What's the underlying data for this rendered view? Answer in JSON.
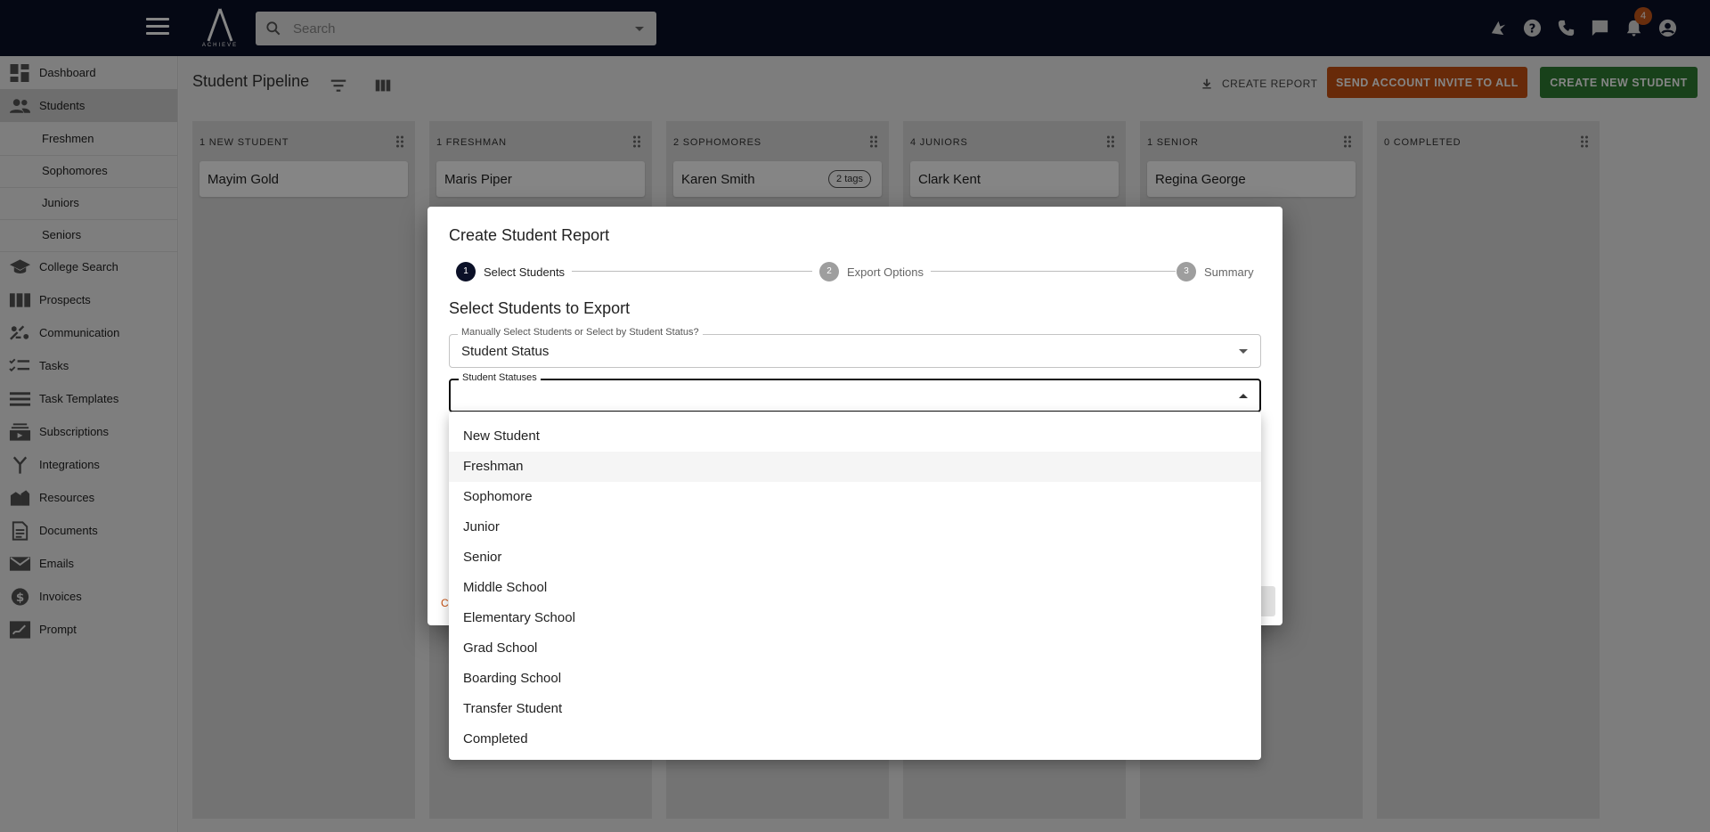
{
  "topbar": {
    "logo_text": "ACHIEVE",
    "search_placeholder": "Search",
    "notification_count": "4"
  },
  "sidebar": {
    "items": [
      {
        "label": "Dashboard",
        "icon": "dashboard-icon"
      },
      {
        "label": "Students",
        "icon": "people-icon"
      },
      {
        "label": "College Search",
        "icon": "school-icon"
      },
      {
        "label": "Prospects",
        "icon": "columns-icon"
      },
      {
        "label": "Communication",
        "icon": "communication-icon"
      },
      {
        "label": "Tasks",
        "icon": "checklist-icon"
      },
      {
        "label": "Task Templates",
        "icon": "list-icon"
      },
      {
        "label": "Subscriptions",
        "icon": "subscriptions-icon"
      },
      {
        "label": "Integrations",
        "icon": "merge-icon"
      },
      {
        "label": "Resources",
        "icon": "resources-icon"
      },
      {
        "label": "Documents",
        "icon": "document-icon"
      },
      {
        "label": "Emails",
        "icon": "mail-icon"
      },
      {
        "label": "Invoices",
        "icon": "dollar-icon"
      },
      {
        "label": "Prompt",
        "icon": "prompt-icon"
      }
    ],
    "student_subitems": [
      "Freshmen",
      "Sophomores",
      "Juniors",
      "Seniors"
    ]
  },
  "main": {
    "title": "Student Pipeline",
    "create_report": "CREATE REPORT",
    "send_invite": "SEND ACCOUNT INVITE TO ALL",
    "create_student": "CREATE NEW STUDENT",
    "columns": [
      {
        "header": "1 NEW STUDENT",
        "card": "Mayim Gold",
        "tag": ""
      },
      {
        "header": "1 FRESHMAN",
        "card": "Maris Piper",
        "tag": ""
      },
      {
        "header": "2 SOPHOMORES",
        "card": "Karen Smith",
        "tag": "2 tags"
      },
      {
        "header": "4 JUNIORS",
        "card": "Clark Kent",
        "tag": ""
      },
      {
        "header": "1 SENIOR",
        "card": "Regina George",
        "tag": ""
      },
      {
        "header": "0 COMPLETED",
        "card": "",
        "tag": ""
      }
    ]
  },
  "modal": {
    "title": "Create Student Report",
    "steps": [
      {
        "number": "1",
        "label": "Select Students"
      },
      {
        "number": "2",
        "label": "Export Options"
      },
      {
        "number": "3",
        "label": "Summary"
      }
    ],
    "section_title": "Select Students to Export",
    "selection_mode": {
      "label": "Manually Select Students or Select by Student Status?",
      "value": "Student Status"
    },
    "statuses_field": {
      "label": "Student Statuses",
      "value": ""
    },
    "cancel_peek": "C"
  },
  "dropdown": {
    "options": [
      "New Student",
      "Freshman",
      "Sophomore",
      "Junior",
      "Senior",
      "Middle School",
      "Elementary School",
      "Grad School",
      "Boarding School",
      "Transfer Student",
      "Completed"
    ],
    "hovered": "Freshman"
  }
}
